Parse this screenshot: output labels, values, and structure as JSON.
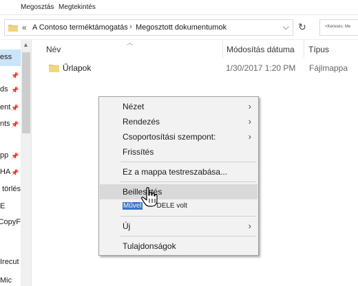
{
  "ribbon": {
    "tabs": [
      "Megosztás",
      "Megtekintés"
    ]
  },
  "address": {
    "separator": "«",
    "crumbs": [
      "A Contoso terméktámogatás",
      "Megosztott dokumentumok"
    ],
    "chevron": "›",
    "dropdown": "⌵",
    "refresh": "↻"
  },
  "search": {
    "placeholder": "<Keresés: Me"
  },
  "nav": {
    "items": [
      "ess",
      "ds",
      "ent",
      "nts",
      "pp",
      "HA",
      "' törlés",
      "E",
      "CopyF",
      "Irecut",
      "Mic"
    ]
  },
  "columns": {
    "name": "Név",
    "date": "Módosítás dátuma",
    "type": "Típus"
  },
  "files": [
    {
      "name": "Űrlapok",
      "date": "1/30/2017 1:20 PM",
      "type": "Fájlmappa"
    }
  ],
  "context_menu": {
    "items": [
      {
        "label": "Nézet",
        "submenu": "›"
      },
      {
        "label": "Rendezés",
        "submenu": "›"
      },
      {
        "label": "Csoportosítási szempont:",
        "submenu": "›"
      },
      {
        "label": "Frissítés"
      },
      {
        "label": "Ez a mappa testreszabása..."
      },
      {
        "label": "Beillesztés"
      },
      {
        "label": "Új",
        "submenu": "›"
      },
      {
        "label": "Tulajdonságok"
      }
    ],
    "undo_prefix": "Művel",
    "undo_suffix": "DELE volt"
  },
  "colors": {
    "accent": "#cce4f7",
    "folder": "#e8c463",
    "highlight": "#d9d9d9"
  }
}
